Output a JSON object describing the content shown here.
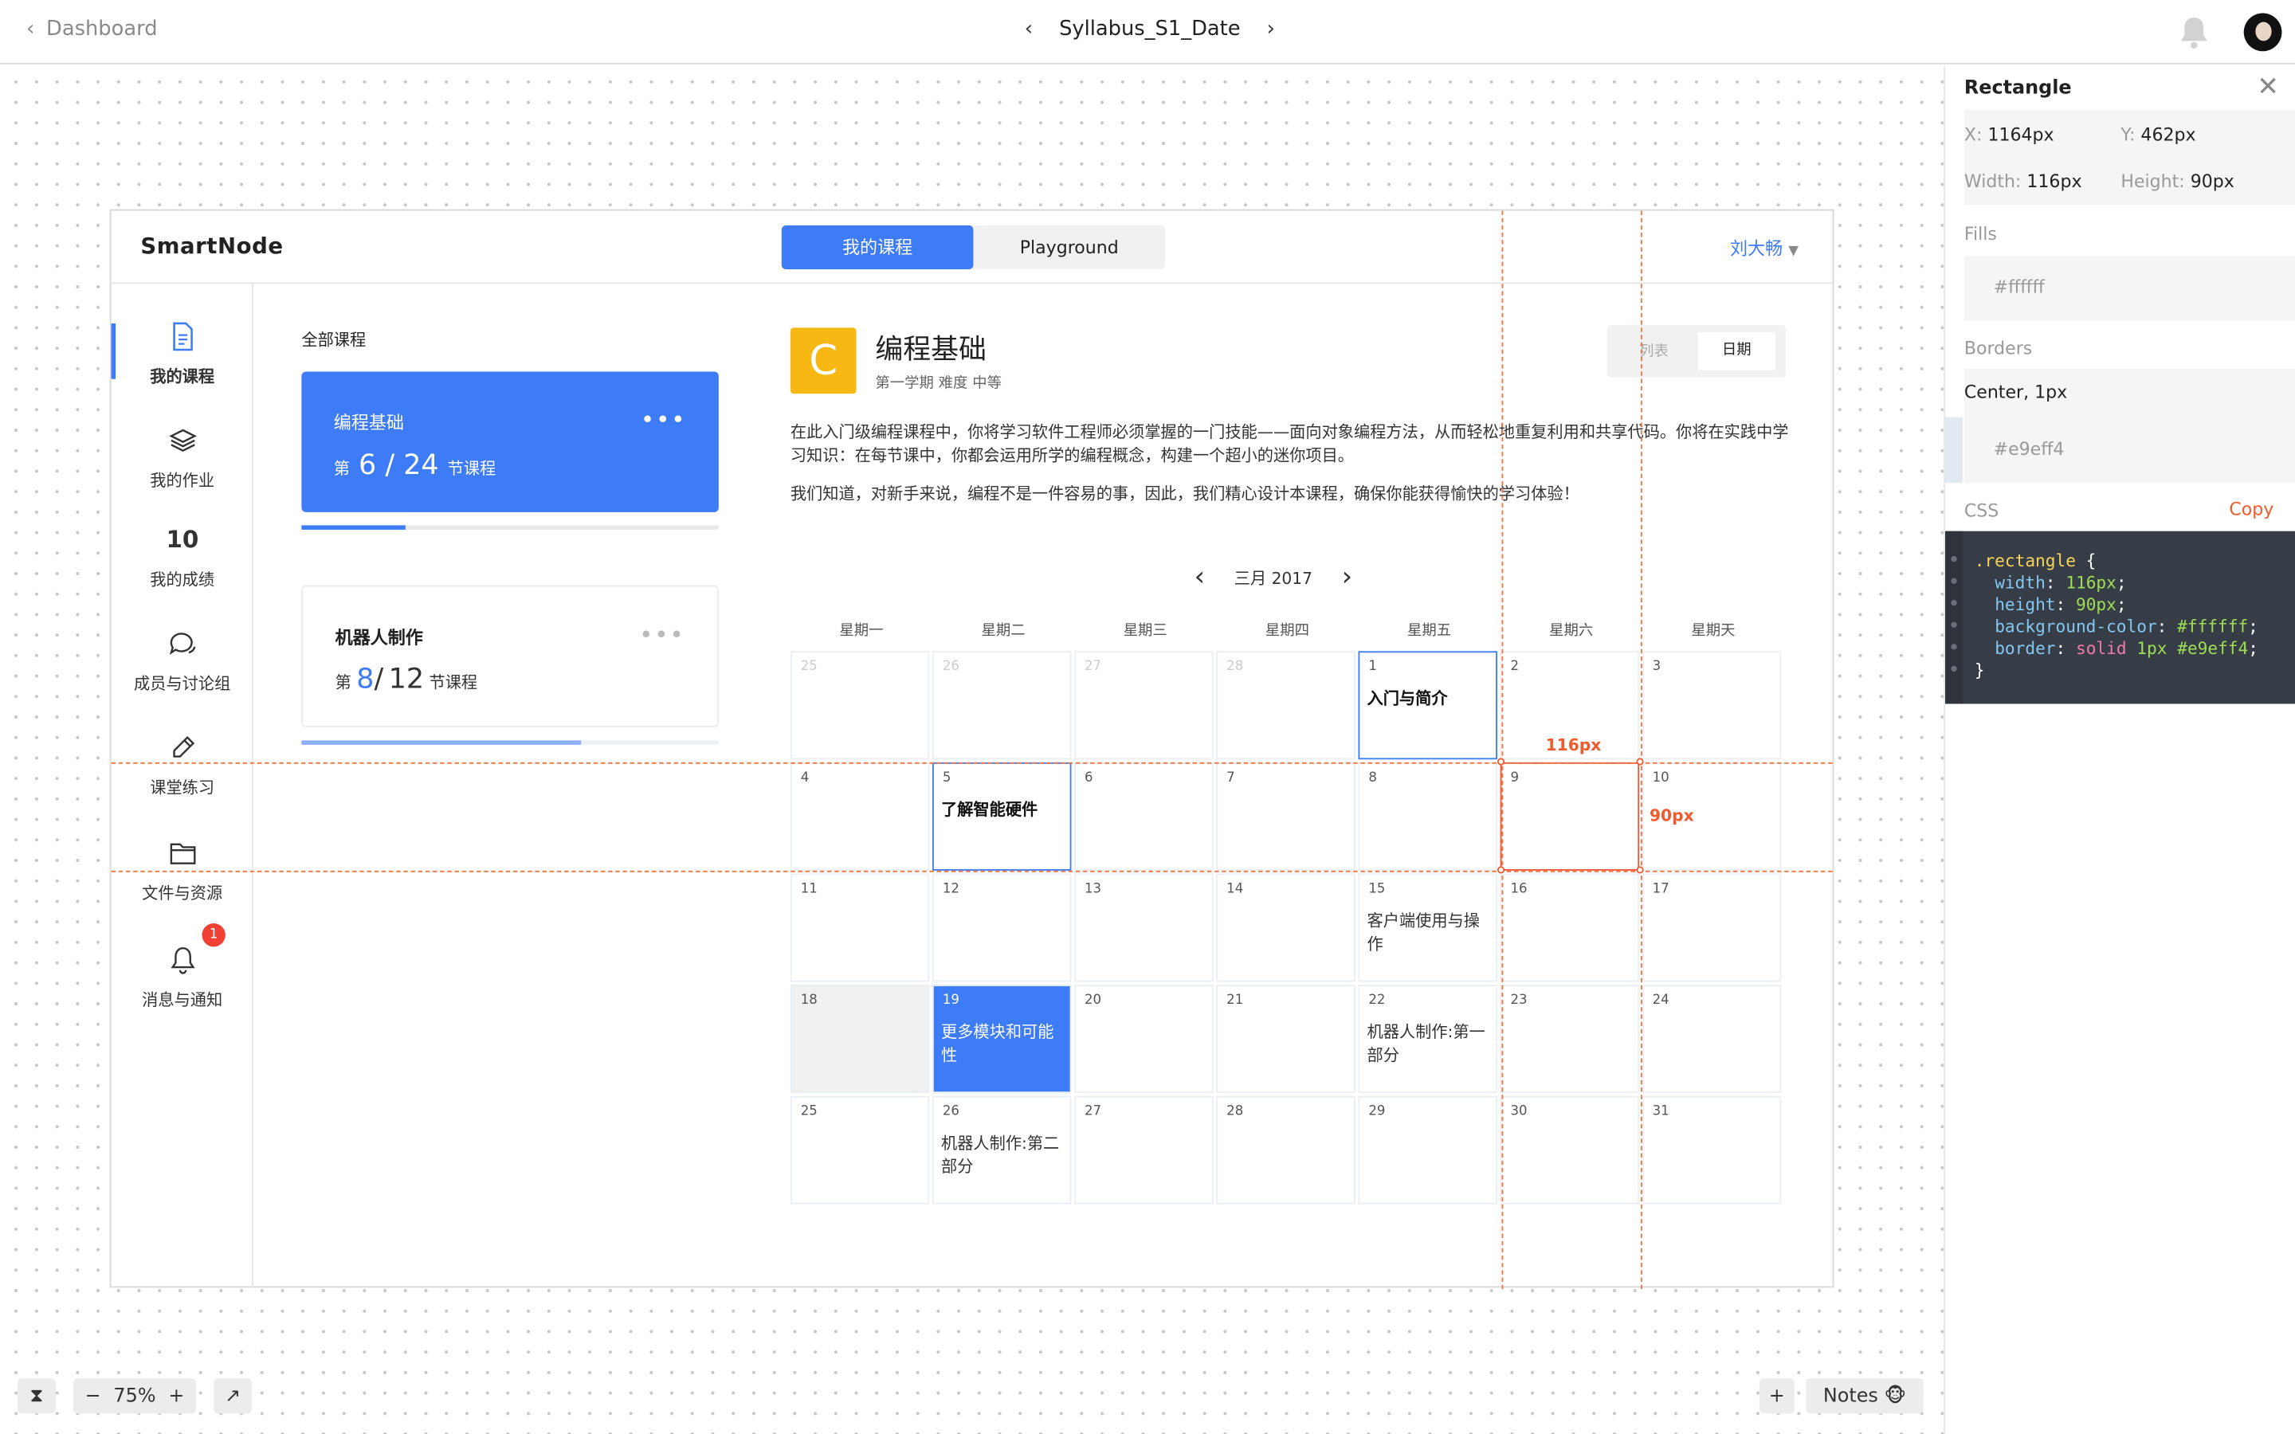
{
  "topbar": {
    "back_label": "Dashboard",
    "doc_title": "Syllabus_S1_Date"
  },
  "app": {
    "brand": "SmartNode",
    "tabs": [
      "我的课程",
      "Playground"
    ],
    "user": "刘大畅",
    "sidebar": [
      {
        "label": "我的课程",
        "icon": "document-icon"
      },
      {
        "label": "我的作业",
        "icon": "layers-icon"
      },
      {
        "label": "我的成绩",
        "icon": "score-10-icon"
      },
      {
        "label": "成员与讨论组",
        "icon": "chat-icon"
      },
      {
        "label": "课堂练习",
        "icon": "pencil-icon"
      },
      {
        "label": "文件与资源",
        "icon": "folder-icon"
      },
      {
        "label": "消息与通知",
        "icon": "bell-icon",
        "badge": "1"
      }
    ],
    "course_list_label": "全部课程",
    "courses": [
      {
        "name": "编程基础",
        "prefix": "第",
        "current": "6",
        "sep": "/",
        "total": "24",
        "suffix": "节课程",
        "progress": 0.25
      },
      {
        "name": "机器人制作",
        "prefix": "第",
        "current": "8",
        "sep": "/",
        "total": "12",
        "suffix": "节课程",
        "progress": 0.67
      }
    ],
    "detail": {
      "logo": "C",
      "title": "编程基础",
      "meta": "第一学期  难度 中等",
      "view_toggle": [
        "列表",
        "日期"
      ],
      "desc1": "在此入门级编程课程中，你将学习软件工程师必须掌握的一门技能——面向对象编程方法，从而轻松地重复利用和共享代码。你将在实践中学习知识：在每节课中，你都会运用所学的编程概念，构建一个超小的迷你项目。",
      "desc2": "我们知道，对新手来说，编程不是一件容易的事，因此，我们精心设计本课程，确保你能获得愉快的学习体验！",
      "month": "三月 2017",
      "weekdays": [
        "星期一",
        "星期二",
        "星期三",
        "星期四",
        "星期五",
        "星期六",
        "星期天"
      ],
      "calendar": [
        [
          {
            "d": "25",
            "m": true
          },
          {
            "d": "26",
            "m": true
          },
          {
            "d": "27",
            "m": true
          },
          {
            "d": "28",
            "m": true
          },
          {
            "d": "1",
            "ev": "入门与简介",
            "s": "sel"
          },
          {
            "d": "2"
          },
          {
            "d": "3"
          }
        ],
        [
          {
            "d": "4"
          },
          {
            "d": "5",
            "ev": "了解智能硬件",
            "s": "sel"
          },
          {
            "d": "6"
          },
          {
            "d": "7"
          },
          {
            "d": "8"
          },
          {
            "d": "9",
            "s": "red"
          },
          {
            "d": "10"
          }
        ],
        [
          {
            "d": "11"
          },
          {
            "d": "12"
          },
          {
            "d": "13"
          },
          {
            "d": "14"
          },
          {
            "d": "15",
            "ev": "客户端使用与操作"
          },
          {
            "d": "16"
          },
          {
            "d": "17"
          }
        ],
        [
          {
            "d": "18",
            "s": "grey"
          },
          {
            "d": "19",
            "ev": "更多模块和可能性",
            "s": "blue"
          },
          {
            "d": "20"
          },
          {
            "d": "21"
          },
          {
            "d": "22",
            "ev": "机器人制作:第一部分"
          },
          {
            "d": "23"
          },
          {
            "d": "24"
          }
        ],
        [
          {
            "d": "25"
          },
          {
            "d": "26",
            "ev": "机器人制作:第二部分"
          },
          {
            "d": "27"
          },
          {
            "d": "28"
          },
          {
            "d": "29"
          },
          {
            "d": "30"
          },
          {
            "d": "31"
          }
        ]
      ]
    }
  },
  "measure": {
    "width_label": "116px",
    "height_label": "90px"
  },
  "bottom": {
    "zoom": "75%",
    "notes": "Notes"
  },
  "inspector": {
    "title": "Rectangle",
    "x_key": "X:",
    "x_val": "1164px",
    "y_key": "Y:",
    "y_val": "462px",
    "w_key": "Width:",
    "w_val": "116px",
    "h_key": "Height:",
    "h_val": "90px",
    "fills_label": "Fills",
    "fill": "#ffffff",
    "borders_label": "Borders",
    "border_desc": "Center, 1px",
    "border_color": "#e9eff4",
    "css_label": "CSS",
    "copy_label": "Copy"
  },
  "colors": {
    "accent": "#3e7bf6",
    "measure": "#f05a2c",
    "logo": "#f7b813",
    "badge": "#f04134"
  }
}
